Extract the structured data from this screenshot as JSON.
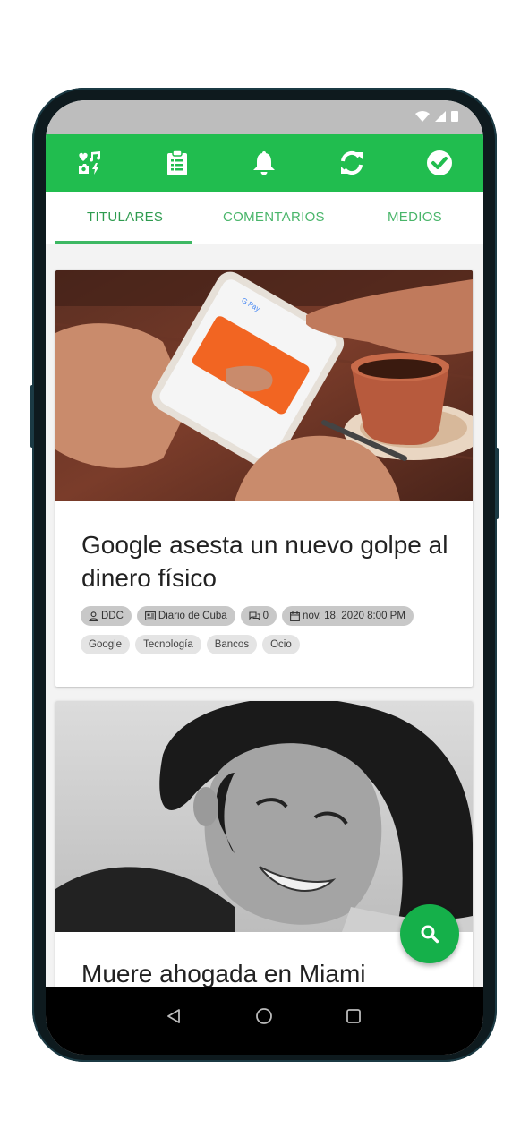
{
  "tabs": [
    {
      "label": "TITULARES"
    },
    {
      "label": "COMENTARIOS"
    },
    {
      "label": "MEDIOS"
    }
  ],
  "appbar_icons": [
    "apps-icon",
    "clipboard-icon",
    "bell-icon",
    "refresh-icon",
    "check-circle-icon"
  ],
  "articles": [
    {
      "title_line1": "Google asesta un nuevo golpe al",
      "title_line2": "dinero físico",
      "author": "DDC",
      "source": "Diario de Cuba",
      "comments": "0",
      "date": "nov. 18, 2020 8:00 PM",
      "tags": [
        "Google",
        "Tecnología",
        "Bancos",
        "Ocio"
      ]
    },
    {
      "title_line1": "Muere ahogada en Miami"
    }
  ],
  "colors": {
    "appbar": "#21bd4f",
    "tab_text": "#49b56a",
    "fab": "#15b04a"
  }
}
